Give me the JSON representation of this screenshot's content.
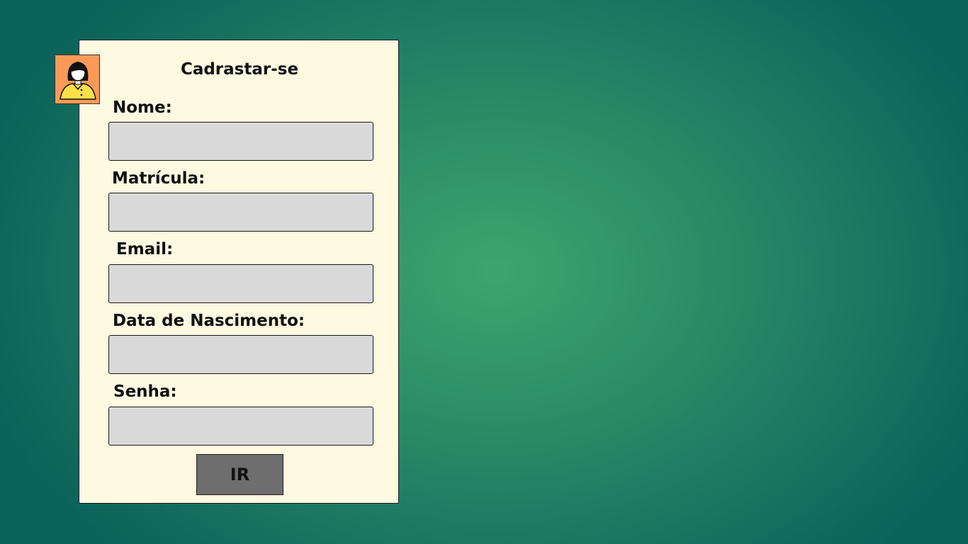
{
  "form": {
    "title": "Cadrastar-se",
    "fields": [
      {
        "label": "Nome:",
        "value": ""
      },
      {
        "label": "Matrícula:",
        "value": ""
      },
      {
        "label": "Email:",
        "value": ""
      },
      {
        "label": "Data de Nascimento:",
        "value": ""
      },
      {
        "label": "Senha:",
        "value": ""
      }
    ],
    "submit_label": "IR"
  },
  "avatar": {
    "icon": "user-avatar-icon",
    "background_color": "#fb9a57",
    "shirt_color": "#fde047"
  },
  "colors": {
    "card_background": "#fef9e1",
    "field_background": "#d9d9d9",
    "button_background": "#6e6e6e",
    "page_background_center": "#3da56e",
    "page_background_edge": "#0b6259"
  }
}
